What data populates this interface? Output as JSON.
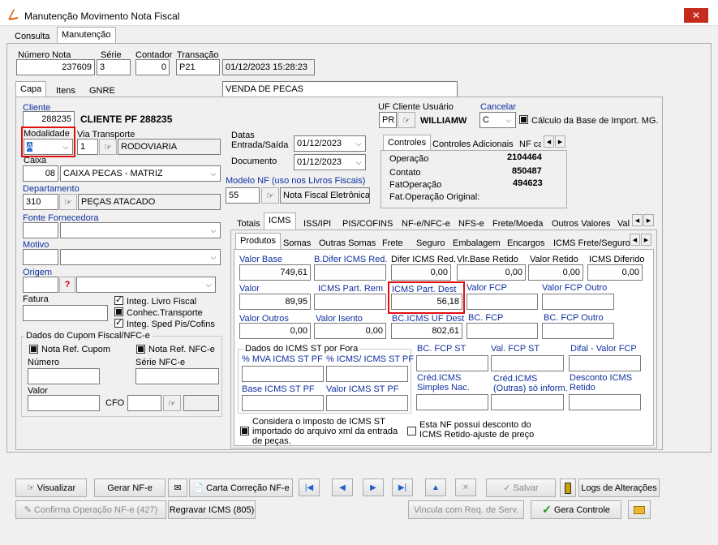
{
  "window": {
    "title": "Manutenção Movimento Nota Fiscal",
    "close": "✕"
  },
  "top_tabs": [
    "Consulta",
    "Manutenção"
  ],
  "header": {
    "numero_nota_label": "Número Nota",
    "numero_nota": "237609",
    "serie_label": "Série",
    "serie": "3",
    "contador_label": "Contador",
    "contador": "0",
    "transacao_label": "Transação",
    "transacao": "P21",
    "datetime": "01/12/2023 15:28:23",
    "descricao": "VENDA DE PECAS"
  },
  "sub_tabs": [
    "Capa",
    "Itens",
    "GNRE"
  ],
  "cliente": {
    "label": "Cliente",
    "code": "288235",
    "name": "CLIENTE PF 288235"
  },
  "modalidade": {
    "label": "Modalidade",
    "value": "A"
  },
  "via_transporte": {
    "label": "Via Transporte",
    "value": "1",
    "name": "RODOVIARIA"
  },
  "caixa": {
    "label": "Caixa",
    "code": "08",
    "name": "CAIXA PECAS - MATRIZ"
  },
  "departamento": {
    "label": "Departamento",
    "code": "310",
    "name": "PEÇAS ATACADO"
  },
  "fonte_fornecedora": {
    "label": "Fonte Fornecedora"
  },
  "motivo": {
    "label": "Motivo"
  },
  "origem": {
    "label": "Origem",
    "icon_text": "?"
  },
  "fatura": {
    "label": "Fatura"
  },
  "checks": {
    "livro_fiscal": "Integ. Livro Fiscal",
    "conhec_transporte": "Conhec.Transporte",
    "sped": "Integ. Sped Pis/Cofins"
  },
  "cupom": {
    "title": "Dados do Cupom Fiscal/NFC-e",
    "nota_ref_cupom": "Nota Ref. Cupom",
    "nota_ref_nfce": "Nota Ref. NFC-e",
    "numero_label": "Número",
    "serie_nfce_label": "Série NFC-e",
    "valor_label": "Valor",
    "cfo_label": "CFO"
  },
  "datas": {
    "title": "Datas",
    "entrada_label": "Entrada/Saída",
    "entrada": "01/12/2023",
    "documento_label": "Documento",
    "documento": "01/12/2023"
  },
  "modelo_nf": {
    "label": "Modelo NF (uso nos Livros Fiscais)",
    "code": "55",
    "name": "Nota Fiscal Eletrônica"
  },
  "uf_cliente": {
    "label": "UF Cliente Usuário",
    "uf": "PR",
    "user": "WILLIAMW"
  },
  "cancelar": {
    "label": "Cancelar",
    "value": "C"
  },
  "calc_base": "Cálculo da Base de Import. MG.",
  "controle_tabs": [
    "Controles",
    "Controles Adicionais",
    "NF ca"
  ],
  "controles": [
    {
      "label": "Operação",
      "value": "2104464"
    },
    {
      "label": "Contato",
      "value": "850487"
    },
    {
      "label": "FatOperação",
      "value": "494623"
    },
    {
      "label": "Fat.Operação Original:",
      "value": ""
    }
  ],
  "tax_tabs": [
    "Totais",
    "ICMS",
    "ISS/IPI",
    "PIS/COFINS",
    "NF-e/NFC-e",
    "NFS-e",
    "Frete/Moeda",
    "Outros Valores",
    "Val"
  ],
  "icms_tabs": [
    "Produtos",
    "Somas",
    "Outras Somas",
    "Frete",
    "Seguro",
    "Embalagem",
    "Encargos",
    "ICMS Frete/Seguro"
  ],
  "icms_fields": {
    "valor_base": {
      "label": "Valor Base",
      "value": "749,61"
    },
    "b_difer": {
      "label": "B.Difer ICMS Red.",
      "value": ""
    },
    "difer_red": {
      "label": "Difer ICMS Red.",
      "value": "0,00"
    },
    "vlr_base_retido": {
      "label": "Vlr.Base Retido",
      "value": "0,00"
    },
    "valor_retido": {
      "label": "Valor Retido",
      "value": "0,00"
    },
    "icms_diferido": {
      "label": "ICMS Diferido",
      "value": "0,00"
    },
    "valor": {
      "label": "Valor",
      "value": "89,95"
    },
    "icms_part_rem": {
      "label": "ICMS Part. Rem",
      "value": ""
    },
    "icms_part_dest": {
      "label": "ICMS Part. Dest",
      "value": "56,18"
    },
    "valor_fcp": {
      "label": "Valor FCP",
      "value": ""
    },
    "valor_fcp_outro": {
      "label": "Valor FCP Outro",
      "value": ""
    },
    "valor_outros": {
      "label": "Valor Outros",
      "value": "0,00"
    },
    "valor_isento": {
      "label": "Valor Isento",
      "value": "0,00"
    },
    "bc_icms_uf_dest": {
      "label": "BC.ICMS UF Dest",
      "value": "802,61"
    },
    "bc_fcp": {
      "label": "BC. FCP",
      "value": ""
    },
    "bc_fcp_outro": {
      "label": "BC. FCP Outro",
      "value": ""
    }
  },
  "st": {
    "title": "Dados do ICMS ST por Fora",
    "mva": "% MVA ICMS ST PF",
    "icms": "% ICMS/ ICMS ST PF",
    "base": "Base ICMS ST PF",
    "valor": "Valor ICMS ST PF"
  },
  "fcp": {
    "bc_fcp_st": "BC. FCP ST",
    "val_fcp_st": "Val. FCP ST",
    "difal": "Difal - Valor FCP",
    "cred_simples": "Créd.ICMS Simples Nac.",
    "cred_outras": "Créd.ICMS (Outras) só inform.",
    "desconto_retido": "Desconto ICMS Retido"
  },
  "considera_st": "Considera o imposto de ICMS ST importado do arquivo xml da entrada de peças.",
  "desconto_nf": "Esta NF possui desconto do ICMS Retido-ajuste de preço",
  "buttons": {
    "visualizar": "Visualizar",
    "gerar_nfe": "Gerar NF-e",
    "carta": "Carta Correção NF-e",
    "salvar": "Salvar",
    "logs": "Logs de Alterações",
    "confirma": "Confirma Operação NF-e (427)",
    "regravar": "Regravar ICMS (805)",
    "vincula": "Vincula com Req. de Serv.",
    "gera_controle": "Gera Controle"
  },
  "colors": {
    "label_blue": "#1030a0",
    "highlight": "#e01010",
    "close_red": "#c42b1c"
  }
}
